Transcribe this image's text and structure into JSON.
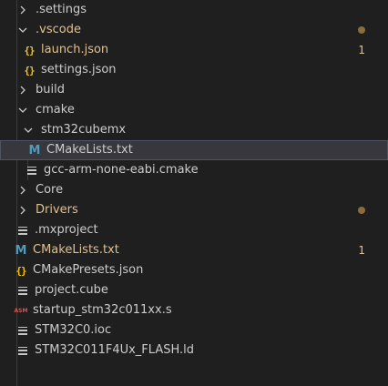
{
  "colors": {
    "background": "#1f1f1f",
    "text": "#cccccc",
    "modified_text": "#e2c08d",
    "dot": "#8a6d3b",
    "cmake_icon": "#519aba",
    "json_icon": "#f1c40f",
    "asm_icon": "#e05050",
    "selected_bg": "#37373d"
  },
  "tree": [
    {
      "type": "folder",
      "expanded": false,
      "label": ".settings",
      "icon": "chevron-right-icon",
      "decoration": ""
    },
    {
      "type": "folder",
      "expanded": true,
      "label": ".vscode",
      "icon": "chevron-down-icon",
      "decoration": "dot",
      "modified": true
    },
    {
      "type": "file",
      "label": "launch.json",
      "icon": "json-braces-icon",
      "decoration": "count",
      "count": "1",
      "modified": true
    },
    {
      "type": "file",
      "label": "settings.json",
      "icon": "json-braces-icon",
      "decoration": ""
    },
    {
      "type": "folder",
      "expanded": false,
      "label": "build",
      "icon": "chevron-right-icon",
      "decoration": ""
    },
    {
      "type": "folder",
      "expanded": true,
      "label": "cmake",
      "icon": "chevron-down-icon",
      "decoration": ""
    },
    {
      "type": "folder",
      "expanded": true,
      "label": "stm32cubemx",
      "icon": "chevron-down-icon",
      "decoration": ""
    },
    {
      "type": "file",
      "label": "CMakeLists.txt",
      "icon": "cmake-m-icon",
      "decoration": "",
      "selected": true
    },
    {
      "type": "file",
      "label": "gcc-arm-none-eabi.cmake",
      "icon": "lines-icon",
      "decoration": ""
    },
    {
      "type": "folder",
      "expanded": false,
      "label": "Core",
      "icon": "chevron-right-icon",
      "decoration": ""
    },
    {
      "type": "folder",
      "expanded": false,
      "label": "Drivers",
      "icon": "chevron-right-icon",
      "decoration": "dot",
      "modified": true
    },
    {
      "type": "file",
      "label": ".mxproject",
      "icon": "lines-icon",
      "decoration": ""
    },
    {
      "type": "file",
      "label": "CMakeLists.txt",
      "icon": "cmake-m-icon",
      "decoration": "count",
      "count": "1",
      "modified": true
    },
    {
      "type": "file",
      "label": "CMakePresets.json",
      "icon": "json-braces-icon",
      "decoration": ""
    },
    {
      "type": "file",
      "label": "project.cube",
      "icon": "lines-icon",
      "decoration": ""
    },
    {
      "type": "file",
      "label": "startup_stm32c011xx.s",
      "icon": "asm-icon",
      "decoration": "",
      "icon_text": "ASM"
    },
    {
      "type": "file",
      "label": "STM32C0.ioc",
      "icon": "lines-icon",
      "decoration": ""
    },
    {
      "type": "file",
      "label": "STM32C011F4Ux_FLASH.ld",
      "icon": "lines-icon",
      "decoration": ""
    }
  ]
}
